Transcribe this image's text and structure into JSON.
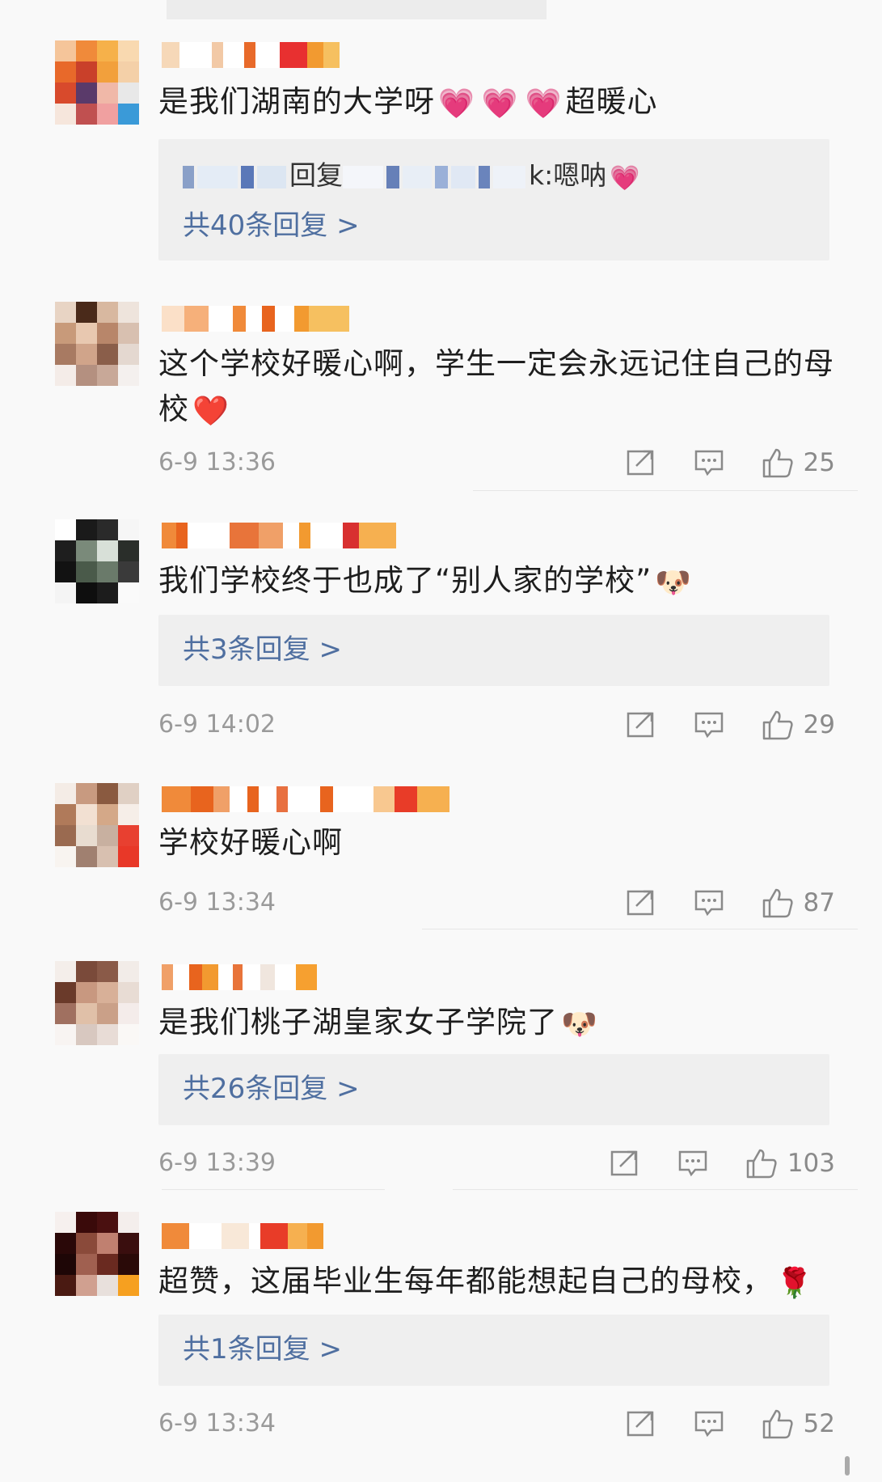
{
  "comments": [
    {
      "text": "是我们湖南的大学呀",
      "emojis_after": [
        "💗",
        "💗",
        "💗"
      ],
      "text_after": "超暖心",
      "reply_snippet": "回复",
      "reply_snippet_tail": "k:嗯呐",
      "reply_snippet_emoji": "💗",
      "reply_count_label": "共40条回复 >",
      "time": "",
      "likes": ""
    },
    {
      "text": "这个学校好暖心啊，学生一定会永远记住自己的母校",
      "emoji_end": "❤️",
      "time": "6-9 13:36",
      "likes": "25"
    },
    {
      "text": "我们学校终于也成了“别人家的学校”",
      "emoji_end": "🐶",
      "reply_count_label": "共3条回复 >",
      "time": "6-9 14:02",
      "likes": "29"
    },
    {
      "text": "学校好暖心啊",
      "time": "6-9 13:34",
      "likes": "87"
    },
    {
      "text": "是我们桃子湖皇家女子学院了",
      "emoji_end": "🐶",
      "reply_count_label": "共26条回复 >",
      "time": "6-9 13:39",
      "likes": "103"
    },
    {
      "text": "超赞，这届毕业生每年都能想起自己的母校，",
      "emoji_end": "🌹",
      "reply_count_label": "共1条回复 >",
      "time": "6-9 13:34",
      "likes": "52"
    }
  ],
  "icons": {
    "share": "share-icon",
    "comment": "comment-icon",
    "like": "like-icon"
  },
  "colors": {
    "link": "#4f6fa0",
    "meta": "#9a9a9a",
    "reply_bg": "#efefef"
  }
}
